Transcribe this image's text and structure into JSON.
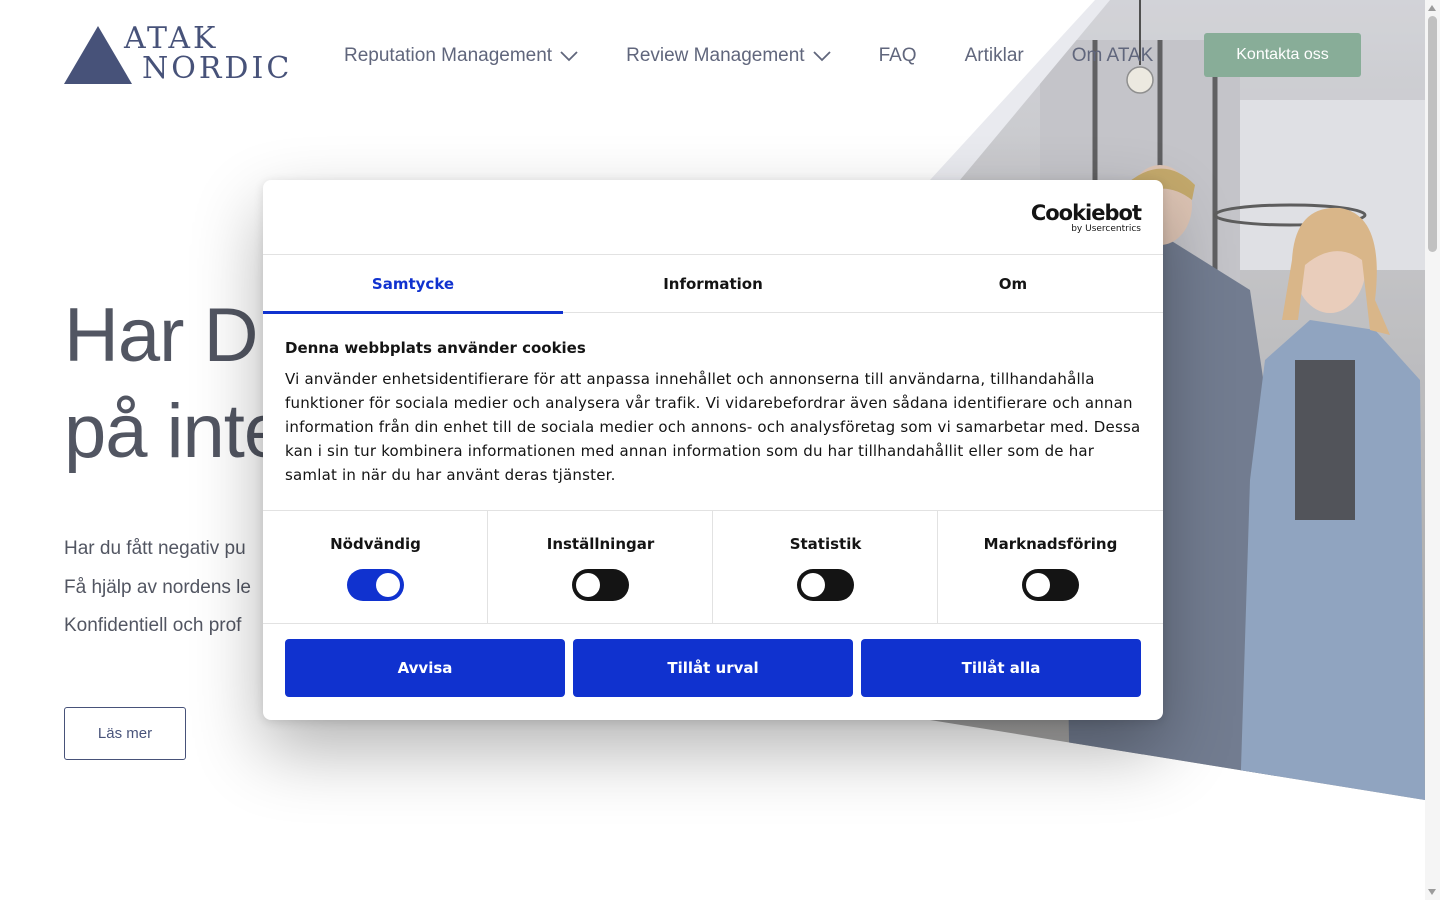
{
  "brand": {
    "line1": "ATAK",
    "line2": "NORDIC"
  },
  "nav": {
    "items": [
      {
        "label": "Reputation Management",
        "dropdown": true
      },
      {
        "label": "Review Management",
        "dropdown": true
      },
      {
        "label": "FAQ",
        "dropdown": false
      },
      {
        "label": "Artiklar",
        "dropdown": false
      },
      {
        "label": "Om ATAK",
        "dropdown": false
      }
    ],
    "cta": "Kontakta oss"
  },
  "hero": {
    "title_line1": "Har DU",
    "title_line2": "på inte",
    "text_line1": "Har du fått negativ pu",
    "text_line2": "Få hjälp av nordens le",
    "text_line3": "Konfidentiell och prof",
    "button": "Läs mer"
  },
  "cookie": {
    "brand": "Cookiebot",
    "brand_sub": "by Usercentrics",
    "tabs": [
      {
        "label": "Samtycke",
        "active": true
      },
      {
        "label": "Information",
        "active": false
      },
      {
        "label": "Om",
        "active": false
      }
    ],
    "heading": "Denna webbplats använder cookies",
    "body": "Vi använder enhetsidentifierare för att anpassa innehållet och annonserna till användarna, tillhandahålla funktioner för sociala medier och analysera vår trafik. Vi vidarebefordrar även sådana identifierare och annan information från din enhet till de sociala medier och annons- och analysföretag som vi samarbetar med. Dessa kan i sin tur kombinera informationen med annan information som du har tillhandahållit eller som de har samlat in när du har använt deras tjänster.",
    "categories": [
      {
        "label": "Nödvändig",
        "checked": true
      },
      {
        "label": "Inställningar",
        "checked": false
      },
      {
        "label": "Statistik",
        "checked": false
      },
      {
        "label": "Marknadsföring",
        "checked": false
      }
    ],
    "buttons": {
      "reject": "Avvisa",
      "allow_selection": "Tillåt urval",
      "allow_all": "Tillåt alla"
    }
  },
  "colors": {
    "brand_navy": "#1f2d5c",
    "cta_green": "#6e9c82",
    "cookie_blue": "#1032cf"
  }
}
